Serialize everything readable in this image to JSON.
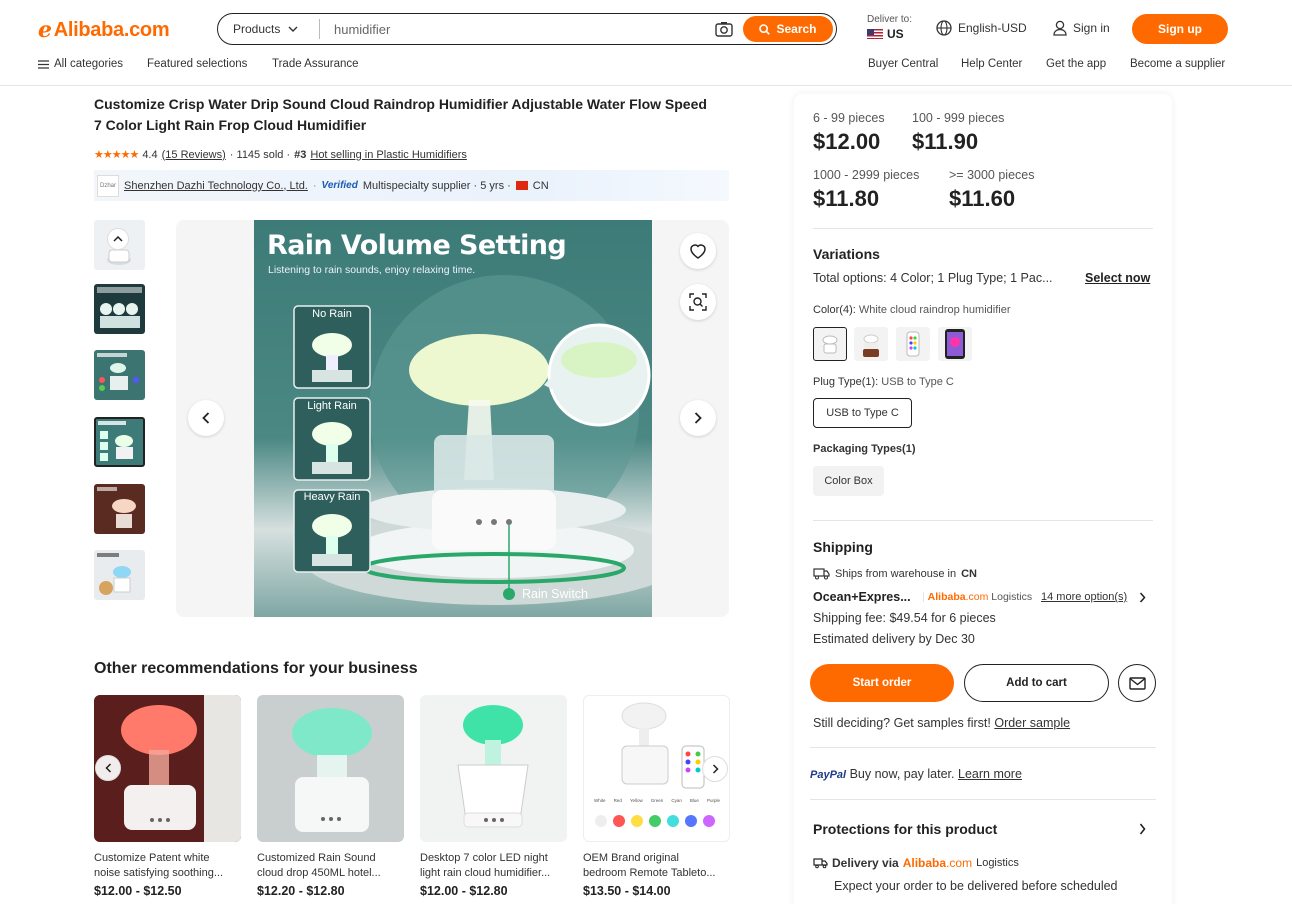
{
  "header": {
    "logo_text": "Alibaba.com",
    "search_category": "Products",
    "search_value": "humidifier",
    "search_button": "Search",
    "deliver_label": "Deliver to:",
    "deliver_country": "US",
    "language": "English-USD",
    "sign_in": "Sign in",
    "sign_up": "Sign up",
    "nav_left": [
      "All categories",
      "Featured selections",
      "Trade Assurance"
    ],
    "nav_right": [
      "Buyer Central",
      "Help Center",
      "Get the app",
      "Become a supplier"
    ]
  },
  "product": {
    "title_line1": "Customize Crisp Water Drip Sound Cloud Raindrop Humidifier Adjustable Water Flow Speed",
    "title_line2": "7 Color Light Rain Frop Cloud Humidifier",
    "rating": "4.4",
    "reviews": "(15 Reviews)",
    "sold": "· 1145 sold ·",
    "rank": "#3",
    "rank_link": "Hot selling in Plastic Humidifiers",
    "supplier_logo": "Dzhar",
    "supplier_name": "Shenzhen Dazhi Technology Co., Ltd.",
    "verified": "Verified",
    "supplier_info": "Multispecialty supplier · 5 yrs ·",
    "supplier_country": "CN",
    "image": {
      "heading": "Rain Volume Setting",
      "subheading": "Listening to rain sounds, enjoy relaxing time.",
      "modes": [
        "No Rain",
        "Light Rain",
        "Heavy Rain"
      ],
      "switch_label": "Rain Switch"
    }
  },
  "recommendations": {
    "title": "Other recommendations for your business",
    "items": [
      {
        "name": "Customize Patent white noise satisfying soothing...",
        "line1": "Customize Patent white",
        "line2": "noise satisfying soothing...",
        "price": "$12.00 - $12.50"
      },
      {
        "name": "Customized Rain Sound cloud drop 450ML hotel...",
        "line1": "Customized Rain Sound",
        "line2": "cloud drop 450ML hotel...",
        "price": "$12.20 - $12.80"
      },
      {
        "name": "Desktop 7 color LED night light rain cloud humidifier...",
        "line1": "Desktop 7 color LED night",
        "line2": "light rain cloud humidifier...",
        "price": "$12.00 - $12.80"
      },
      {
        "name": "OEM Brand original bedroom Remote Tableto...",
        "line1": "OEM Brand original",
        "line2": "bedroom Remote Tableto...",
        "price": "$13.50 - $14.00"
      }
    ],
    "rec4_colors": [
      "White",
      "Red",
      "Yellow",
      "Green",
      "Cyan",
      "Blue",
      "Purple"
    ]
  },
  "pricing": {
    "tiers": [
      {
        "range": "6 - 99 pieces",
        "price": "$12.00"
      },
      {
        "range": "100 - 999 pieces",
        "price": "$11.90"
      },
      {
        "range": "1000 - 2999 pieces",
        "price": "$11.80"
      },
      {
        "range": ">= 3000 pieces",
        "price": "$11.60"
      }
    ]
  },
  "variations": {
    "title": "Variations",
    "total_label": "Total options:",
    "total_value": "4 Color; 1 Plug Type; 1 Pac...",
    "select_now": "Select now",
    "color_label": "Color(4):",
    "color_value": "White cloud raindrop humidifier",
    "plug_label": "Plug Type(1):",
    "plug_value": "USB to Type C",
    "plug_option": "USB to Type C",
    "packaging_label": "Packaging Types(1)",
    "packaging_option": "Color Box"
  },
  "shipping": {
    "title": "Shipping",
    "ships_from": "Ships from warehouse in",
    "ships_country": "CN",
    "method": "Ocean+Expres...",
    "logistics_brand": "Alibaba",
    "logistics_brand_suffix": ".com",
    "logistics_word": "Logistics",
    "more_options": "14 more option(s)",
    "fee": "Shipping fee: $49.54 for 6 pieces",
    "delivery": "Estimated delivery by Dec 30"
  },
  "actions": {
    "start_order": "Start order",
    "add_to_cart": "Add to cart",
    "samples_text": "Still deciding? Get samples first!",
    "order_sample": "Order sample"
  },
  "paypal": {
    "brand": "PayPal",
    "text": "Buy now, pay later.",
    "link": "Learn more"
  },
  "protections": {
    "title": "Protections for this product",
    "delivery_label": "Delivery via",
    "delivery_brand": "Alibaba",
    "delivery_brand_suffix": ".com",
    "delivery_word": "Logistics",
    "delivery_text": "Expect your order to be delivered before scheduled"
  }
}
